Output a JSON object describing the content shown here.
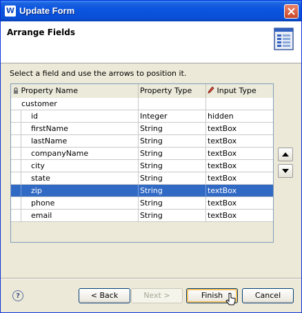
{
  "window": {
    "title": "Update Form",
    "app_icon": "W"
  },
  "header": {
    "title": "Arrange Fields",
    "icon": "form-layout-icon"
  },
  "instruction": "Select a field and use the arrows to position it.",
  "table": {
    "columns": [
      "Property Name",
      "Property Type",
      "Input Type"
    ],
    "group": "customer",
    "rows": [
      {
        "name": "id",
        "type": "Integer",
        "input": "hidden",
        "selected": false
      },
      {
        "name": "firstName",
        "type": "String",
        "input": "textBox",
        "selected": false
      },
      {
        "name": "lastName",
        "type": "String",
        "input": "textBox",
        "selected": false
      },
      {
        "name": "companyName",
        "type": "String",
        "input": "textBox",
        "selected": false
      },
      {
        "name": "city",
        "type": "String",
        "input": "textBox",
        "selected": false
      },
      {
        "name": "state",
        "type": "String",
        "input": "textBox",
        "selected": false
      },
      {
        "name": "zip",
        "type": "String",
        "input": "textBox",
        "selected": true
      },
      {
        "name": "phone",
        "type": "String",
        "input": "textBox",
        "selected": false
      },
      {
        "name": "email",
        "type": "String",
        "input": "textBox",
        "selected": false
      }
    ]
  },
  "buttons": {
    "back": "< Back",
    "next": "Next >",
    "finish": "Finish",
    "cancel": "Cancel"
  },
  "colors": {
    "selection": "#316ac5",
    "titlebar": "#0a4fd6",
    "dialog_bg": "#ece9d8"
  }
}
